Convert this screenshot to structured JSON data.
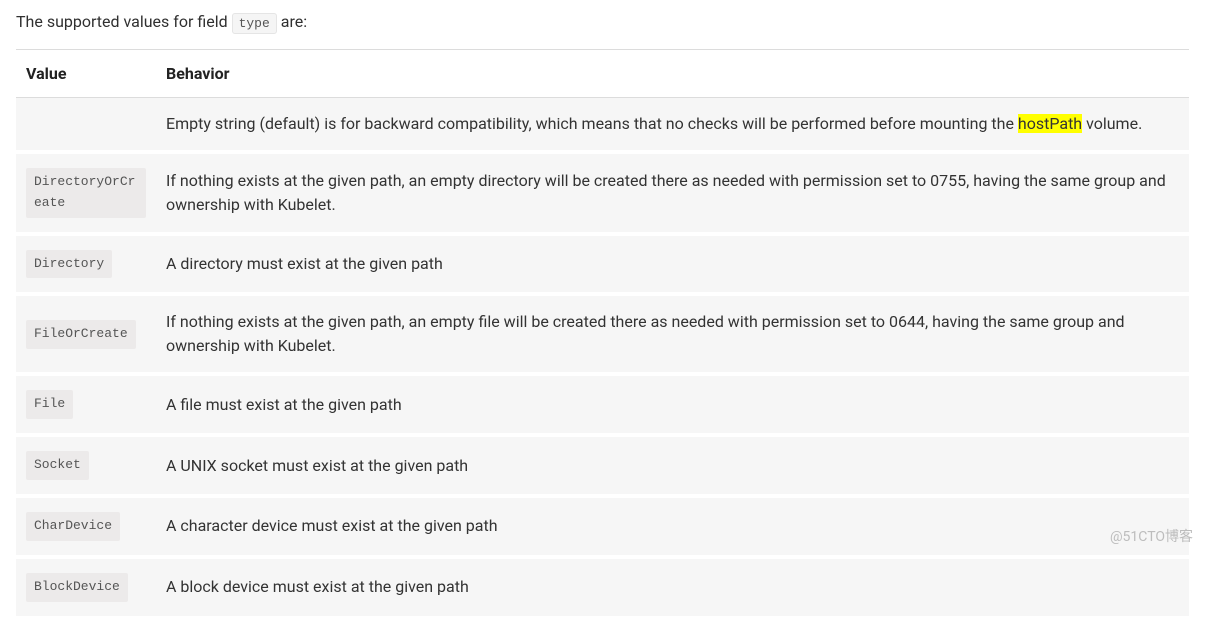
{
  "intro": {
    "before": "The supported values for field ",
    "code": "type",
    "after": " are:"
  },
  "table": {
    "headers": {
      "value": "Value",
      "behavior": "Behavior"
    },
    "rows": [
      {
        "value": "",
        "behavior_pre": "Empty string (default) is for backward compatibility, which means that no checks will be performed before mounting the ",
        "behavior_hl": "hostPath",
        "behavior_post": " volume."
      },
      {
        "value": "DirectoryOrCreate",
        "behavior": "If nothing exists at the given path, an empty directory will be created there as needed with permission set to 0755, having the same group and ownership with Kubelet."
      },
      {
        "value": "Directory",
        "behavior": "A directory must exist at the given path"
      },
      {
        "value": "FileOrCreate",
        "behavior": "If nothing exists at the given path, an empty file will be created there as needed with permission set to 0644, having the same group and ownership with Kubelet."
      },
      {
        "value": "File",
        "behavior": "A file must exist at the given path"
      },
      {
        "value": "Socket",
        "behavior": "A UNIX socket must exist at the given path"
      },
      {
        "value": "CharDevice",
        "behavior": "A character device must exist at the given path"
      },
      {
        "value": "BlockDevice",
        "behavior": "A block device must exist at the given path"
      }
    ]
  },
  "watermark": "@51CTO博客"
}
